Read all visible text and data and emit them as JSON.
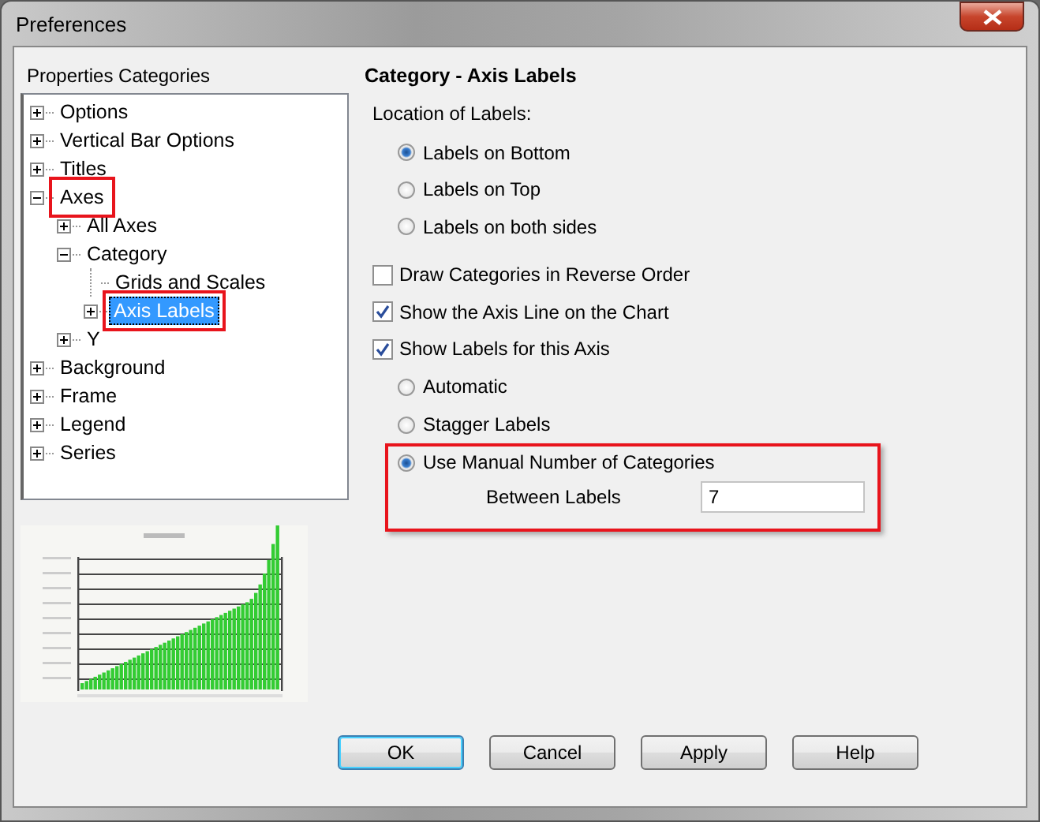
{
  "window": {
    "title": "Preferences"
  },
  "categories": {
    "title": "Properties Categories",
    "tree": [
      {
        "label": "Options",
        "kind": "folder",
        "expanded": false,
        "selected": false,
        "highlighted": false
      },
      {
        "label": "Vertical Bar Options",
        "kind": "folder",
        "expanded": false,
        "selected": false,
        "highlighted": false
      },
      {
        "label": "Titles",
        "kind": "folder",
        "expanded": false,
        "selected": false,
        "highlighted": false
      },
      {
        "label": "Axes",
        "kind": "folder",
        "expanded": true,
        "selected": false,
        "highlighted": true,
        "children": [
          {
            "label": "All Axes",
            "kind": "folder",
            "expanded": false,
            "selected": false,
            "highlighted": false
          },
          {
            "label": "Category",
            "kind": "folder",
            "expanded": true,
            "selected": false,
            "highlighted": false,
            "children": [
              {
                "label": "Grids and Scales",
                "kind": "leaf",
                "selected": false,
                "highlighted": false
              },
              {
                "label": "Axis Labels",
                "kind": "folder",
                "expanded": false,
                "selected": true,
                "highlighted": true
              }
            ]
          },
          {
            "label": "Y",
            "kind": "folder",
            "expanded": false,
            "selected": false,
            "highlighted": false
          }
        ]
      },
      {
        "label": "Background",
        "kind": "folder",
        "expanded": false,
        "selected": false,
        "highlighted": false
      },
      {
        "label": "Frame",
        "kind": "folder",
        "expanded": false,
        "selected": false,
        "highlighted": false
      },
      {
        "label": "Legend",
        "kind": "folder",
        "expanded": false,
        "selected": false,
        "highlighted": false
      },
      {
        "label": "Series",
        "kind": "folder",
        "expanded": false,
        "selected": false,
        "highlighted": false
      }
    ]
  },
  "panel": {
    "heading": "Category - Axis Labels",
    "location_label": "Location of Labels:",
    "location_options": [
      {
        "label": "Labels on Bottom",
        "selected": true
      },
      {
        "label": "Labels on Top",
        "selected": false
      },
      {
        "label": "Labels on both sides",
        "selected": false
      }
    ],
    "checks": [
      {
        "label": "Draw Categories in Reverse Order",
        "checked": false
      },
      {
        "label": "Show the Axis Line on the Chart",
        "checked": true
      },
      {
        "label": "Show Labels for this Axis",
        "checked": true
      }
    ],
    "label_modes": [
      {
        "label": "Automatic",
        "selected": false
      },
      {
        "label": "Stagger Labels",
        "selected": false
      }
    ],
    "manual": {
      "highlighted": true,
      "option": {
        "label": "Use Manual Number of Categories",
        "selected": true
      },
      "field_label": "Between Labels",
      "value": "7"
    }
  },
  "buttons": [
    {
      "label": "OK",
      "default": true
    },
    {
      "label": "Cancel",
      "default": false
    },
    {
      "label": "Apply",
      "default": false
    },
    {
      "label": "Help",
      "default": false
    }
  ]
}
